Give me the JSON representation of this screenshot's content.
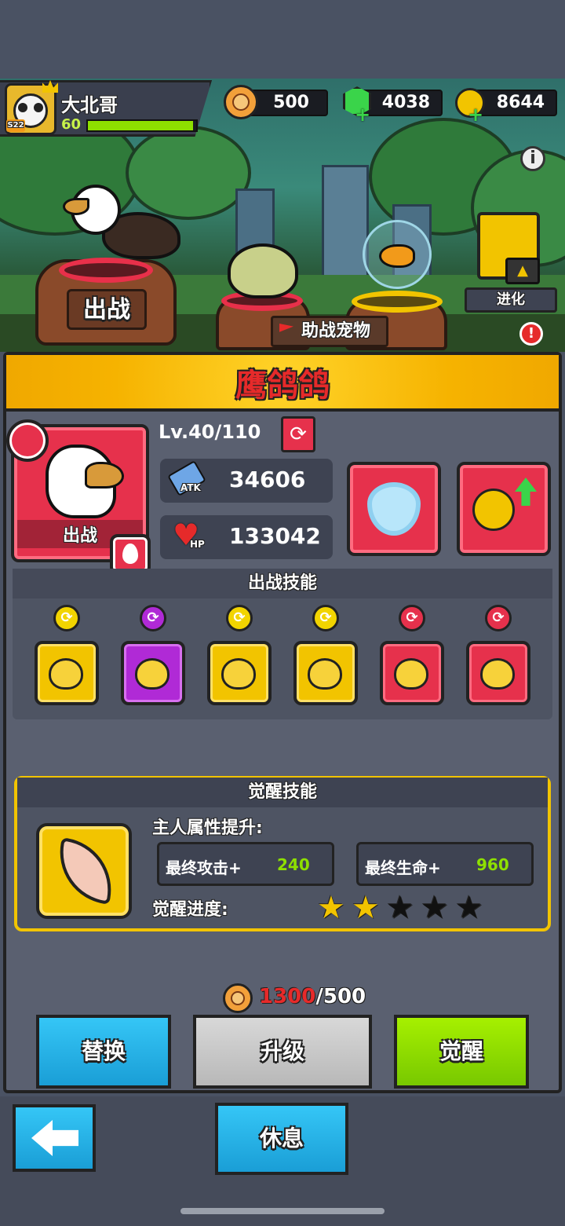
{
  "player": {
    "name": "大北哥",
    "level": "60",
    "badge": "S22",
    "exp_fraction": 0.97
  },
  "currencies": [
    {
      "icon": "lion-coin-icon",
      "value": "500"
    },
    {
      "icon": "green-gem-icon",
      "value": "4038"
    },
    {
      "icon": "gold-coin-icon",
      "value": "8644"
    }
  ],
  "scene": {
    "deploy_label": "出战",
    "assist_label": "助战宠物",
    "evolve_label": "进化"
  },
  "pet": {
    "name": "鹰鸽鸽",
    "level": "Lv.40/110",
    "status_label": "出战",
    "atk_label": "ATK",
    "atk": "34606",
    "hp_label": "HP",
    "hp": "133042"
  },
  "battle_skills": {
    "title": "出战技能",
    "slots": [
      {
        "color": "yellow",
        "badge_color": "#f2d400",
        "icon": "paw-heal-icon"
      },
      {
        "color": "purple",
        "badge_color": "#b02ad6",
        "icon": "paw-fire-icon"
      },
      {
        "color": "yellow",
        "badge_color": "#f2d400",
        "icon": "paw-percent-icon"
      },
      {
        "color": "yellow",
        "badge_color": "#f2d400",
        "icon": "paw-cooldown-icon"
      },
      {
        "color": "red",
        "badge_color": "#e6314c",
        "icon": "cactus-paw-icon"
      },
      {
        "color": "red",
        "badge_color": "#e6314c",
        "icon": "paw-up-icon"
      }
    ]
  },
  "awaken": {
    "title": "觉醒技能",
    "bonus_label": "主人属性提升:",
    "atk_label": "最终攻击+",
    "atk_value": "240",
    "hp_label": "最终生命+",
    "hp_value": "960",
    "progress_label": "觉醒进度:",
    "stars_filled": 2,
    "stars_total": 5
  },
  "cost": {
    "have": "1300",
    "separator": "/",
    "need": "500"
  },
  "buttons": {
    "replace": "替换",
    "upgrade": "升级",
    "awaken": "觉醒",
    "rest": "休息"
  },
  "colors": {
    "accent_yellow": "#f6b300",
    "card_red": "#e6314c",
    "btn_blue": "#2bb6ec",
    "btn_green": "#8ee000",
    "btn_gray": "#c8c8c8",
    "cost_red": "#e62a2a"
  }
}
